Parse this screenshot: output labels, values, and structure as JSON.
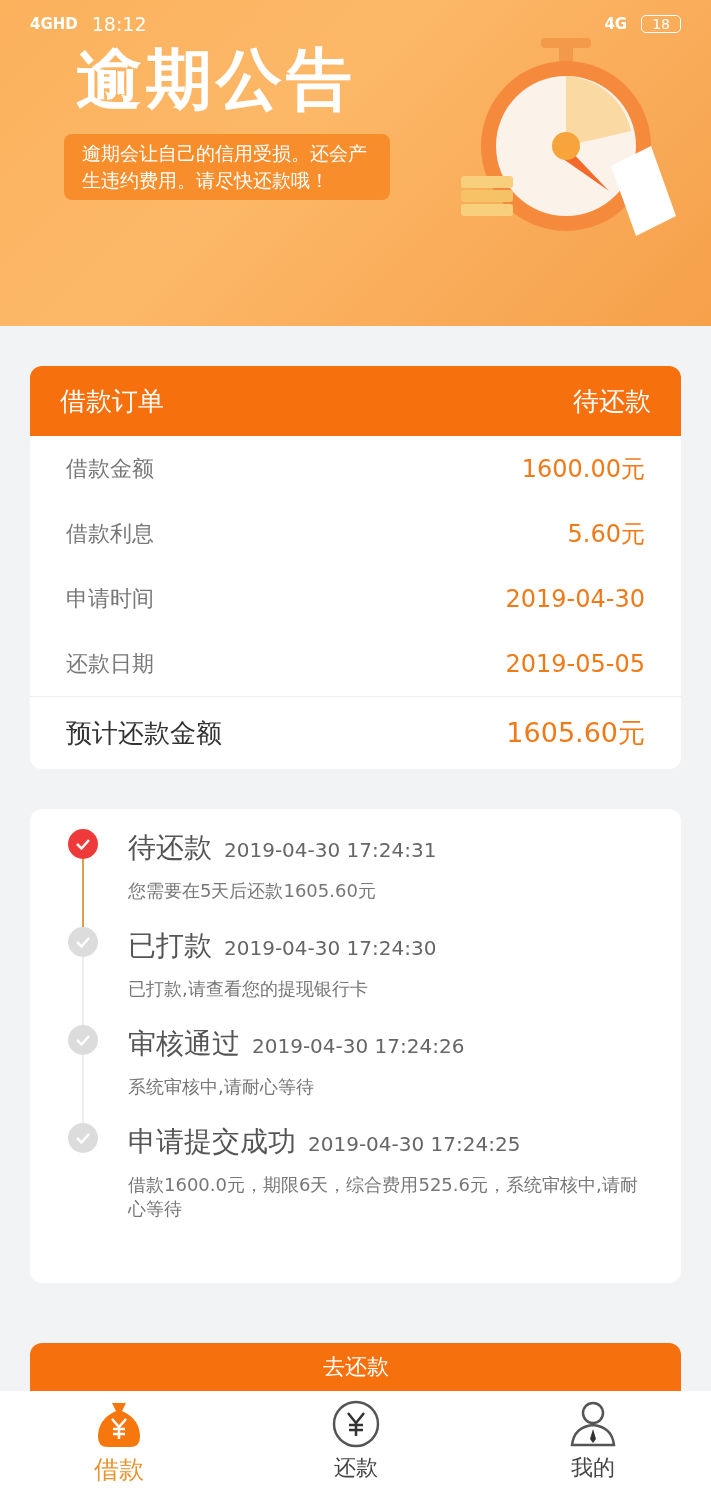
{
  "status_bar": {
    "network_left": "4GHD",
    "time": "18:12",
    "network_right": "4G",
    "battery": "18"
  },
  "banner": {
    "title": "逾期公告",
    "message": "逾期会让自己的信用受损。还会产生违约费用。请尽快还款哦！"
  },
  "order": {
    "title": "借款订单",
    "status": "待还款",
    "rows": [
      {
        "label": "借款金额",
        "value": "1600.00元"
      },
      {
        "label": "借款利息",
        "value": "5.60元"
      },
      {
        "label": "申请时间",
        "value": "2019-04-30"
      },
      {
        "label": "还款日期",
        "value": "2019-05-05"
      }
    ],
    "total": {
      "label": "预计还款金额",
      "value": "1605.60元"
    }
  },
  "timeline": [
    {
      "title": "待还款",
      "time": "2019-04-30 17:24:31",
      "detail": "您需要在5天后还款1605.60元",
      "current": true
    },
    {
      "title": "已打款",
      "time": "2019-04-30 17:24:30",
      "detail": "已打款,请查看您的提现银行卡",
      "current": false
    },
    {
      "title": "审核通过",
      "time": "2019-04-30 17:24:26",
      "detail": "系统审核中,请耐心等待",
      "current": false
    },
    {
      "title": "申请提交成功",
      "time": "2019-04-30 17:24:25",
      "detail": "借款1600.0元，期限6天，综合费用525.6元，系统审核中,请耐心等待",
      "current": false
    }
  ],
  "action_button": "去还款",
  "tabs": [
    {
      "label": "借款",
      "kind": "loan",
      "selected": true
    },
    {
      "label": "还款",
      "kind": "repay",
      "selected": false
    },
    {
      "label": "我的",
      "kind": "me",
      "selected": false
    }
  ]
}
